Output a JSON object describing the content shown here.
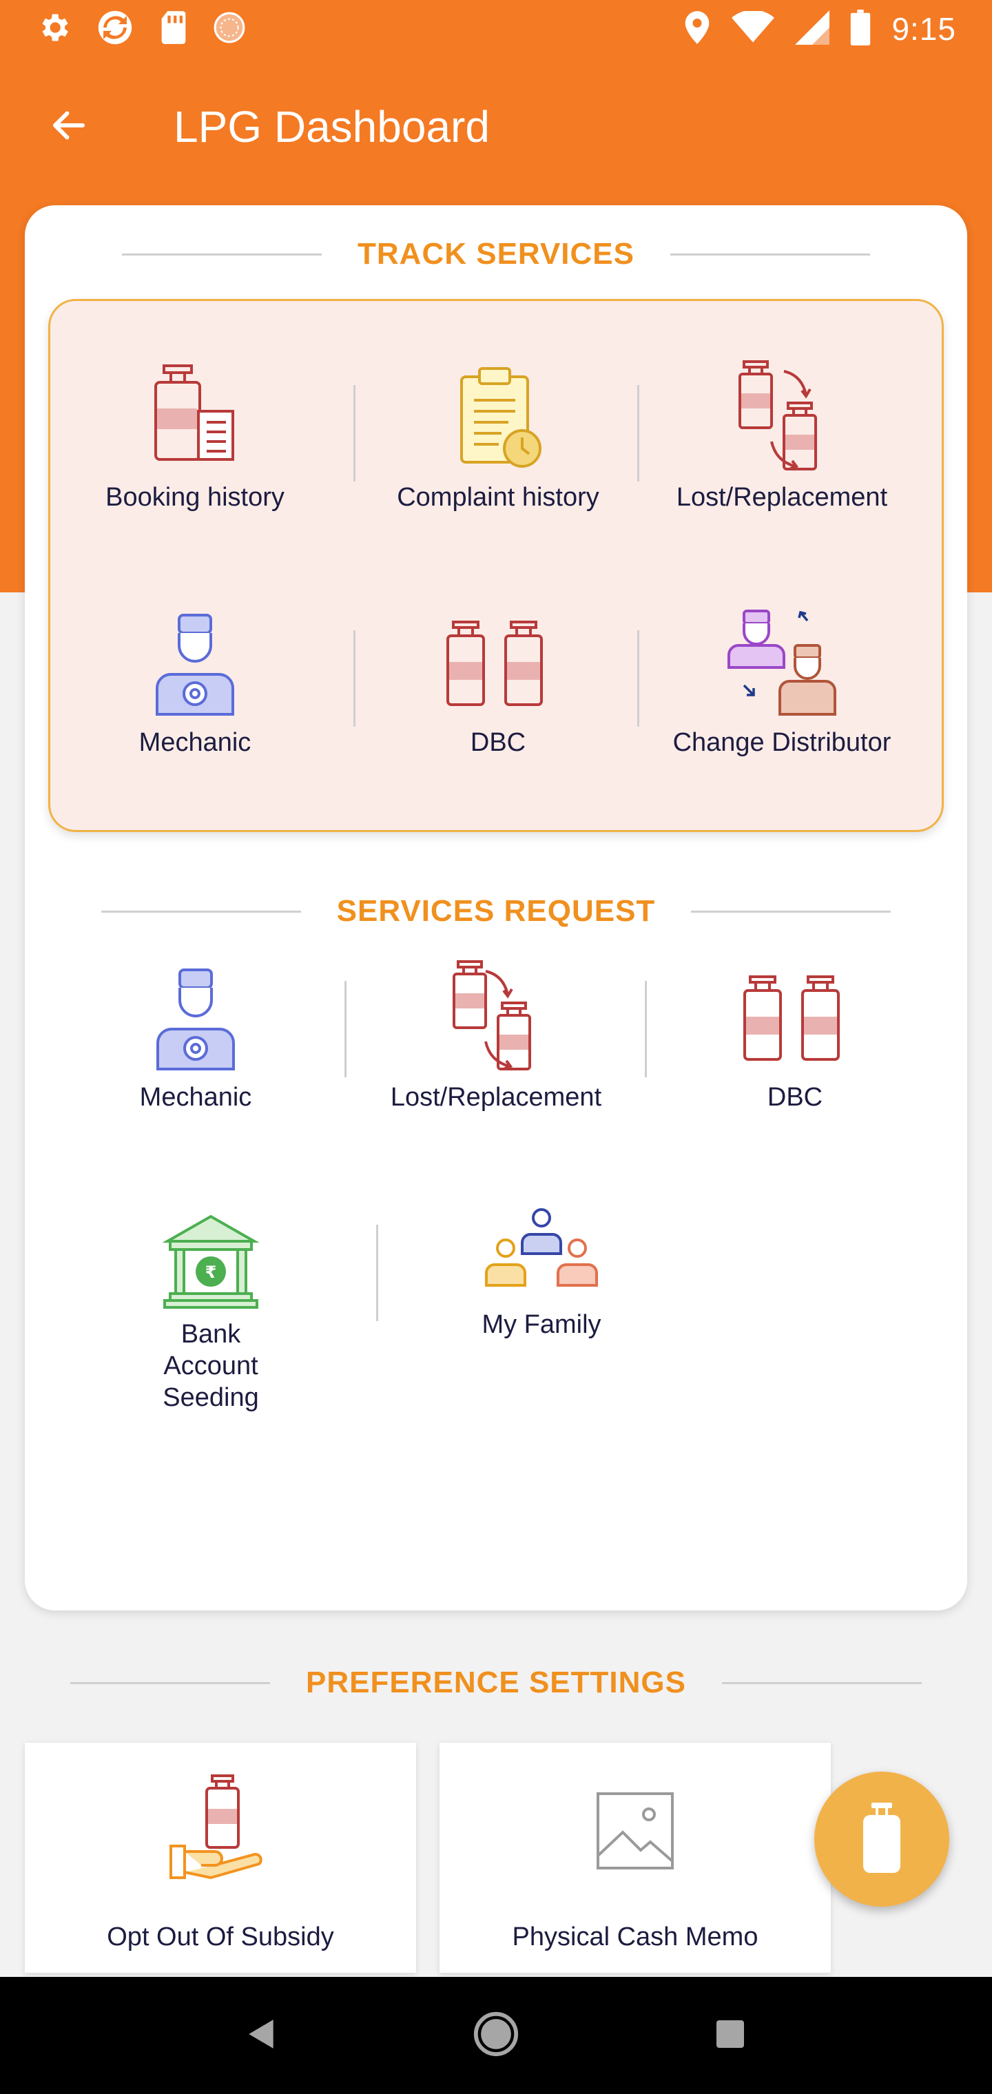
{
  "status_bar": {
    "time": "9:15"
  },
  "app_bar": {
    "title": "LPG Dashboard"
  },
  "track_services": {
    "title": "TRACK SERVICES",
    "items": [
      {
        "label": "Booking history",
        "icon": "booking-history-icon"
      },
      {
        "label": "Complaint history",
        "icon": "complaint-history-icon"
      },
      {
        "label": "Lost/Replacement",
        "icon": "lost-replacement-icon"
      },
      {
        "label": "Mechanic",
        "icon": "mechanic-icon"
      },
      {
        "label": "DBC",
        "icon": "dbc-icon"
      },
      {
        "label": "Change Distributor",
        "icon": "change-distributor-icon"
      }
    ]
  },
  "services_request": {
    "title": "SERVICES REQUEST",
    "items": [
      {
        "label": "Mechanic",
        "icon": "mechanic-icon"
      },
      {
        "label": "Lost/Replacement",
        "icon": "lost-replacement-icon"
      },
      {
        "label": "DBC",
        "icon": "dbc-icon"
      },
      {
        "label": "Bank Account Seeding",
        "icon": "bank-icon"
      },
      {
        "label": "My Family",
        "icon": "family-icon"
      }
    ]
  },
  "preference_settings": {
    "title": "PREFERENCE SETTINGS",
    "items": [
      {
        "label": "Opt Out Of Subsidy",
        "icon": "subsidy-hand-icon"
      },
      {
        "label": "Physical Cash Memo",
        "icon": "image-placeholder-icon"
      }
    ]
  },
  "colors": {
    "primary": "#f47a24",
    "section_title": "#f0901e",
    "track_box_bg": "#fbece8",
    "track_box_border": "#f2b245",
    "fab": "#f2b24a"
  }
}
